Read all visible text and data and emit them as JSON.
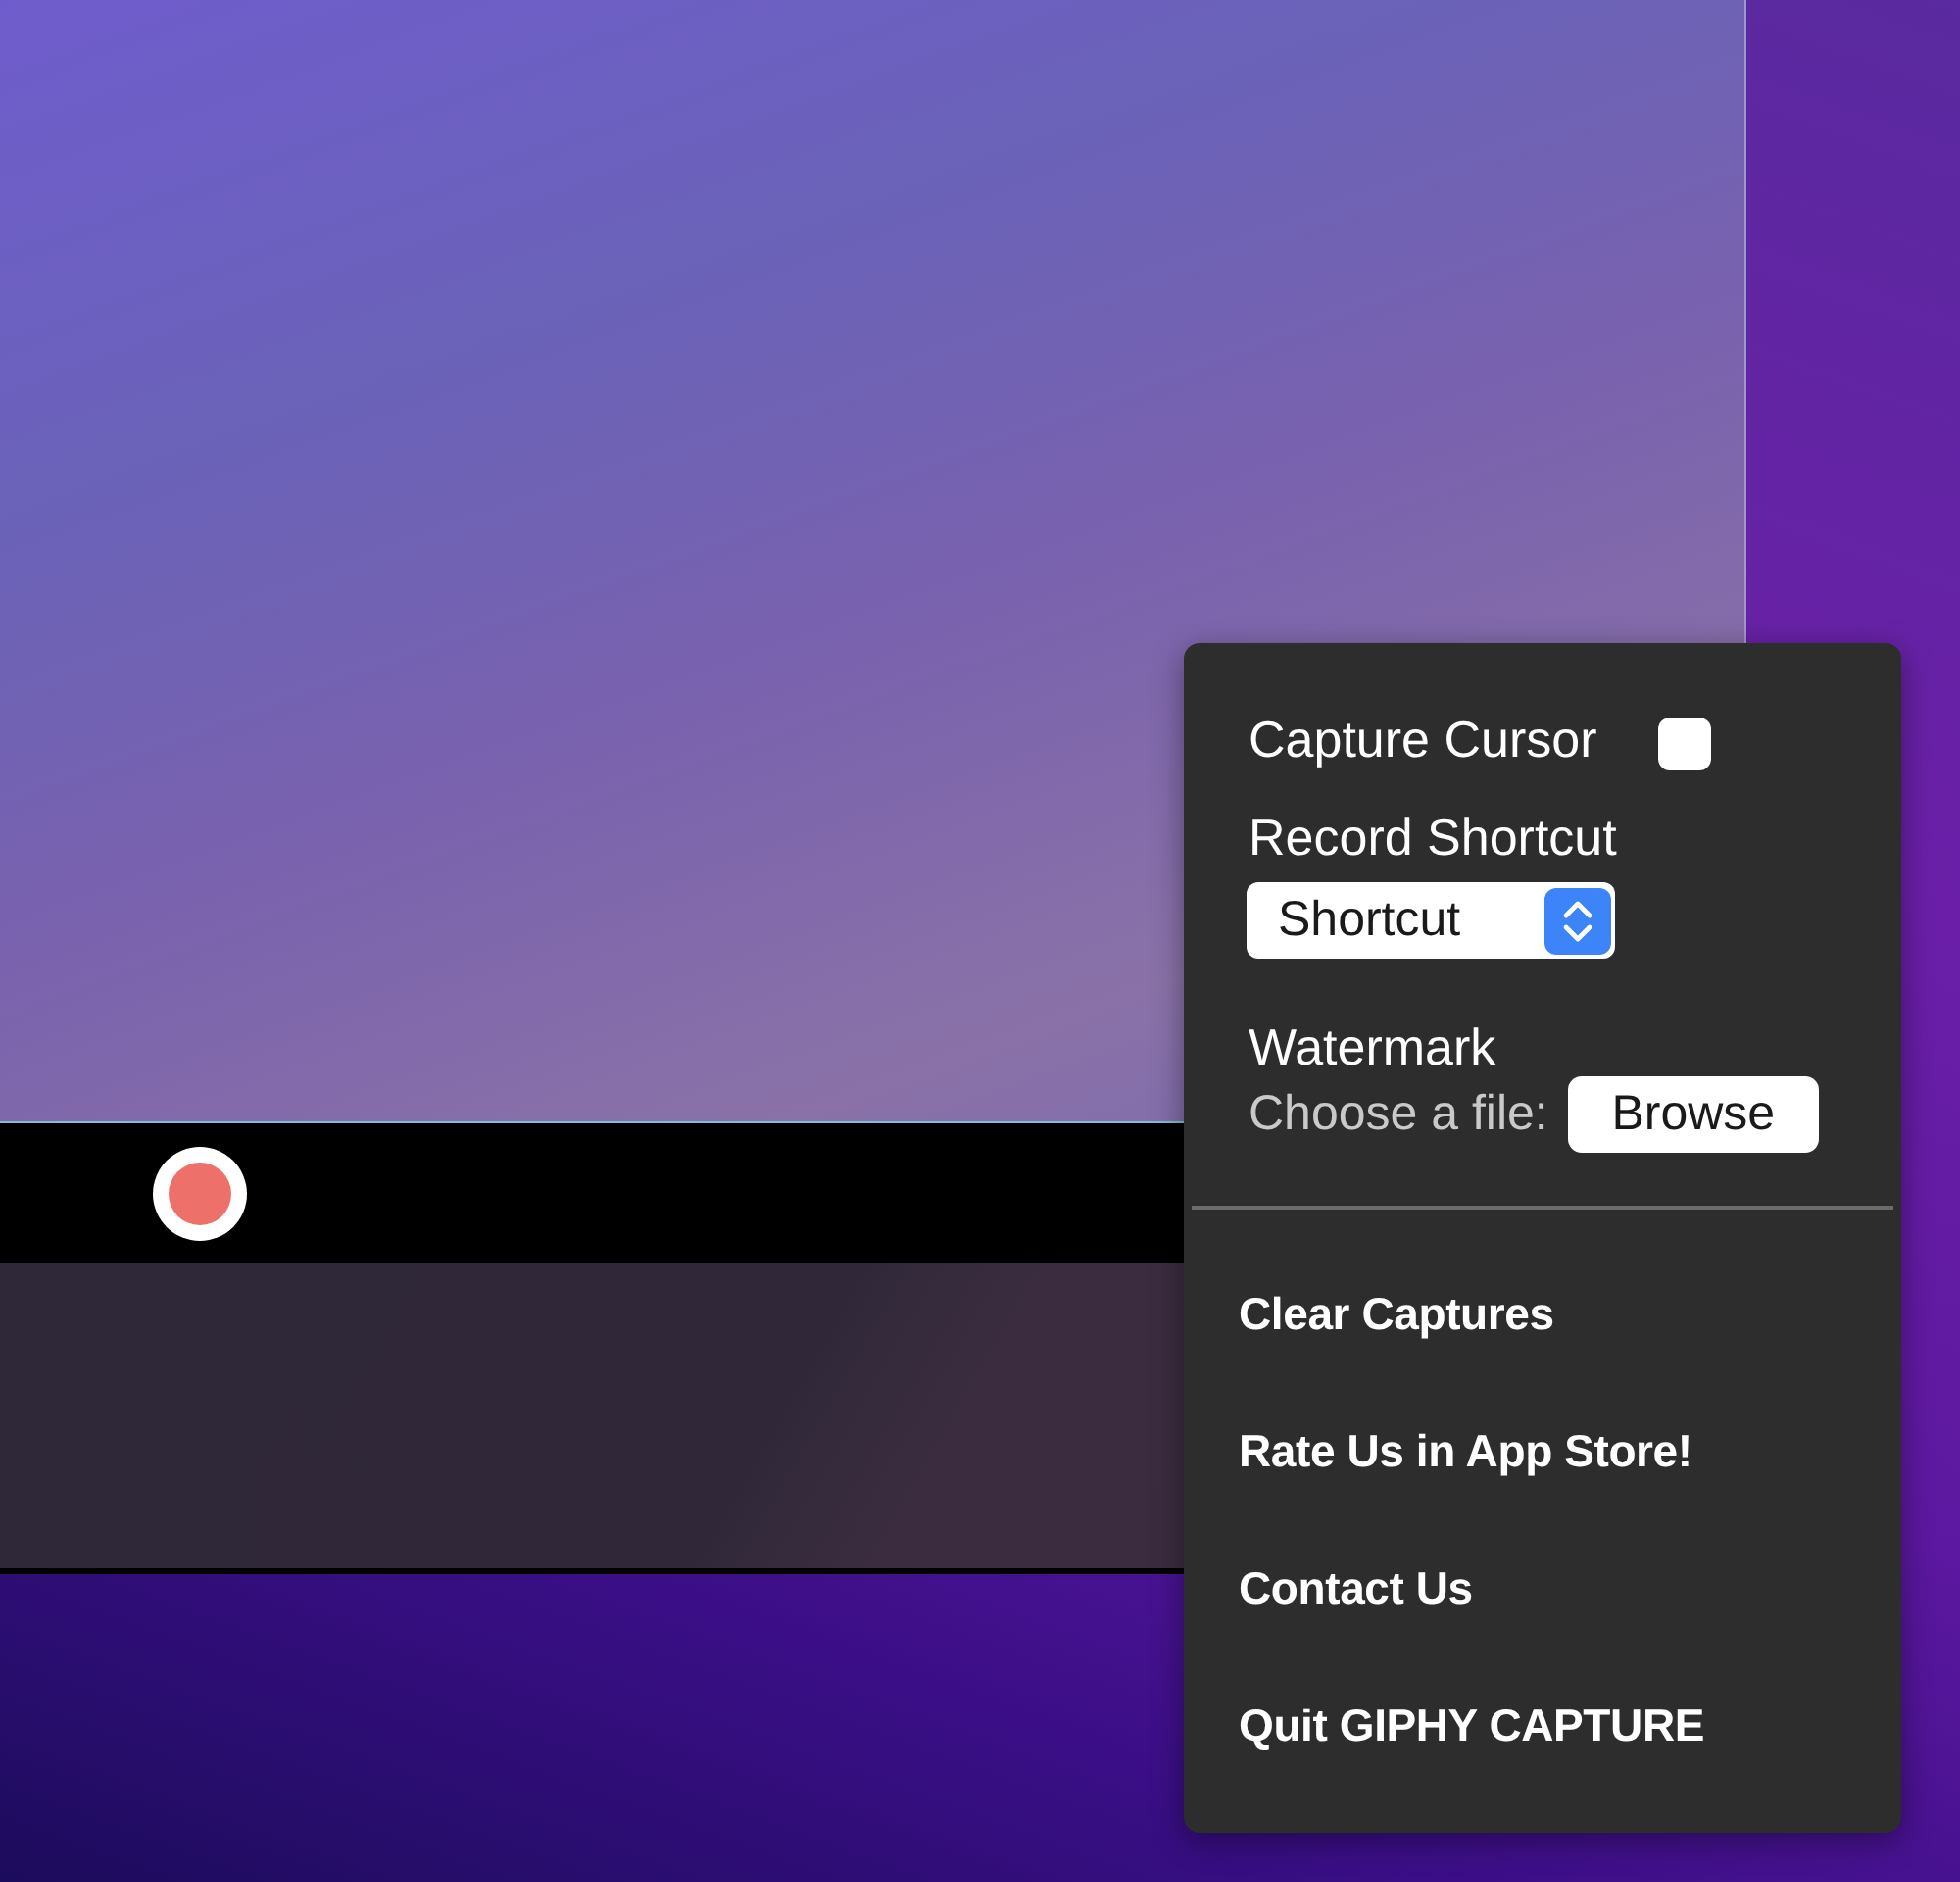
{
  "menu": {
    "capture_cursor": {
      "label": "Capture Cursor",
      "checked": false
    },
    "record_shortcut": {
      "label": "Record Shortcut",
      "value": "Shortcut"
    },
    "watermark": {
      "label": "Watermark",
      "choose_label": "Choose a file:",
      "button": "Browse"
    },
    "actions": [
      "Clear Captures",
      "Rate Us in App Store!",
      "Contact Us",
      "Quit GIPHY CAPTURE"
    ]
  }
}
